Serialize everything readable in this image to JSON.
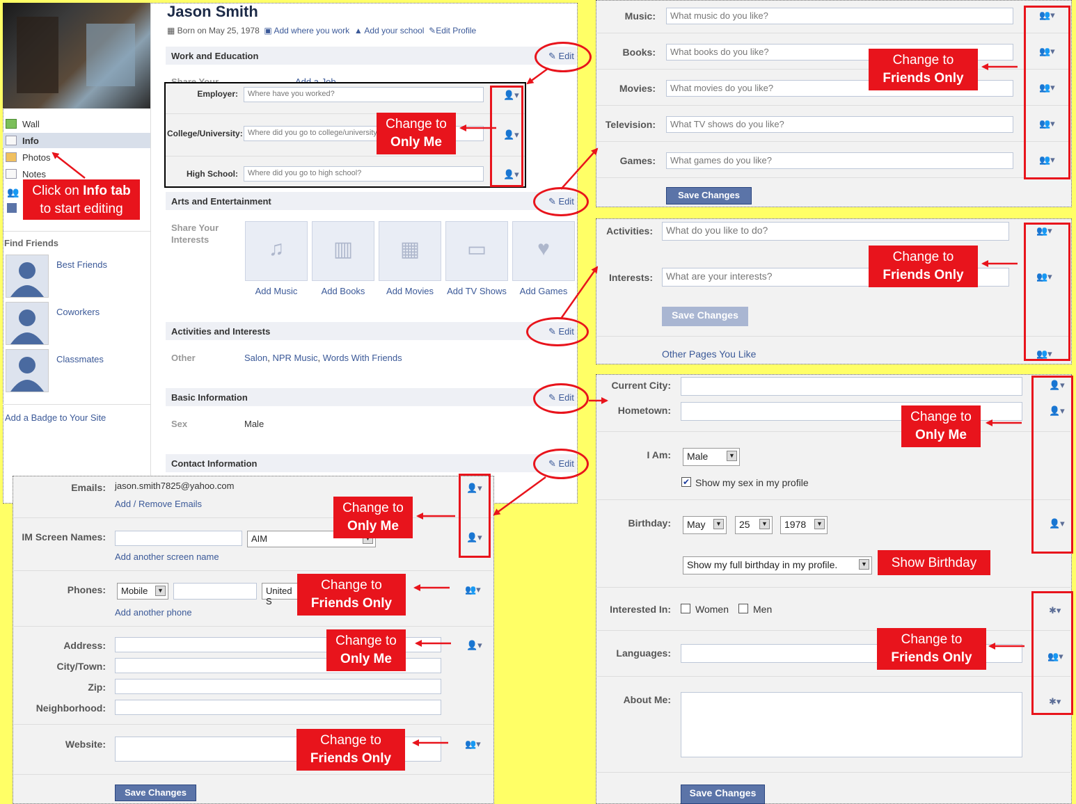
{
  "profile": {
    "name": "Jason Smith",
    "born": "Born on May 25, 1978",
    "add_work": "Add where you work",
    "add_school": "Add your school",
    "edit_profile": "Edit Profile"
  },
  "sidebar": {
    "nav": [
      "Wall",
      "Info",
      "Photos",
      "Notes"
    ],
    "find_friends": "Find Friends",
    "lists": [
      "Best Friends",
      "Coworkers",
      "Classmates"
    ],
    "badge": "Add a Badge to Your Site"
  },
  "edit_label": "Edit",
  "work": {
    "header": "Work and Education",
    "share_text": "Share Your",
    "add_job": "Add a Job",
    "employer_label": "Employer:",
    "employer_ph": "Where have you worked?",
    "college_label": "College/University:",
    "college_ph": "Where did you go to college/university?",
    "hs_label": "High School:",
    "hs_ph": "Where did you go to high school?"
  },
  "arts": {
    "header": "Arts and Entertainment",
    "share_l1": "Share Your",
    "share_l2": "Interests",
    "items": [
      "Add Music",
      "Add Books",
      "Add Movies",
      "Add TV Shows",
      "Add Games"
    ]
  },
  "activities": {
    "header": "Activities and Interests",
    "other_label": "Other",
    "links": [
      "Salon",
      "NPR Music",
      "Words With Friends"
    ]
  },
  "basic": {
    "header": "Basic Information",
    "sex_label": "Sex",
    "sex_value": "Male"
  },
  "contact": {
    "header": "Contact Information",
    "emails_label": "Emails:",
    "email_value": "jason.smith7825@yahoo.com",
    "add_remove_emails": "Add / Remove Emails",
    "im_label": "IM Screen Names:",
    "im_service": "AIM",
    "add_screen_name": "Add another screen name",
    "phones_label": "Phones:",
    "phone_type": "Mobile",
    "phone_country": "United S",
    "add_phone": "Add another phone",
    "address_label": "Address:",
    "city_label": "City/Town:",
    "zip_label": "Zip:",
    "neighborhood_label": "Neighborhood:",
    "website_label": "Website:",
    "save": "Save Changes"
  },
  "interests": {
    "music_label": "Music:",
    "music_ph": "What music do you like?",
    "books_label": "Books:",
    "books_ph": "What books do you like?",
    "movies_label": "Movies:",
    "movies_ph": "What movies do you like?",
    "tv_label": "Television:",
    "tv_ph": "What TV shows do you like?",
    "games_label": "Games:",
    "games_ph": "What games do you like?",
    "save": "Save Changes"
  },
  "act_panel": {
    "activities_label": "Activities:",
    "activities_ph": "What do you like to do?",
    "interests_label": "Interests:",
    "interests_ph": "What are your interests?",
    "save": "Save Changes",
    "other_pages": "Other Pages You Like"
  },
  "basic_panel": {
    "city_label": "Current City:",
    "hometown_label": "Hometown:",
    "iam_label": "I Am:",
    "iam_value": "Male",
    "show_sex": "Show my sex in my profile",
    "birthday_label": "Birthday:",
    "bday_month": "May",
    "bday_day": "25",
    "bday_year": "1978",
    "bday_show": "Show my full birthday in my profile.",
    "interested_label": "Interested In:",
    "women": "Women",
    "men": "Men",
    "languages_label": "Languages:",
    "about_label": "About Me:",
    "save": "Save Changes"
  },
  "callouts": {
    "info_l1_pre": "Click on ",
    "info_l1_bold": "Info tab",
    "info_l2": "to start editing",
    "change_to": "Change to",
    "only_me": "Only Me",
    "friends_only": "Friends Only",
    "show_birthday": "Show Birthday"
  },
  "colors": {
    "accent": "#e8141c",
    "brand": "#3b5998",
    "background": "#ffff66"
  }
}
